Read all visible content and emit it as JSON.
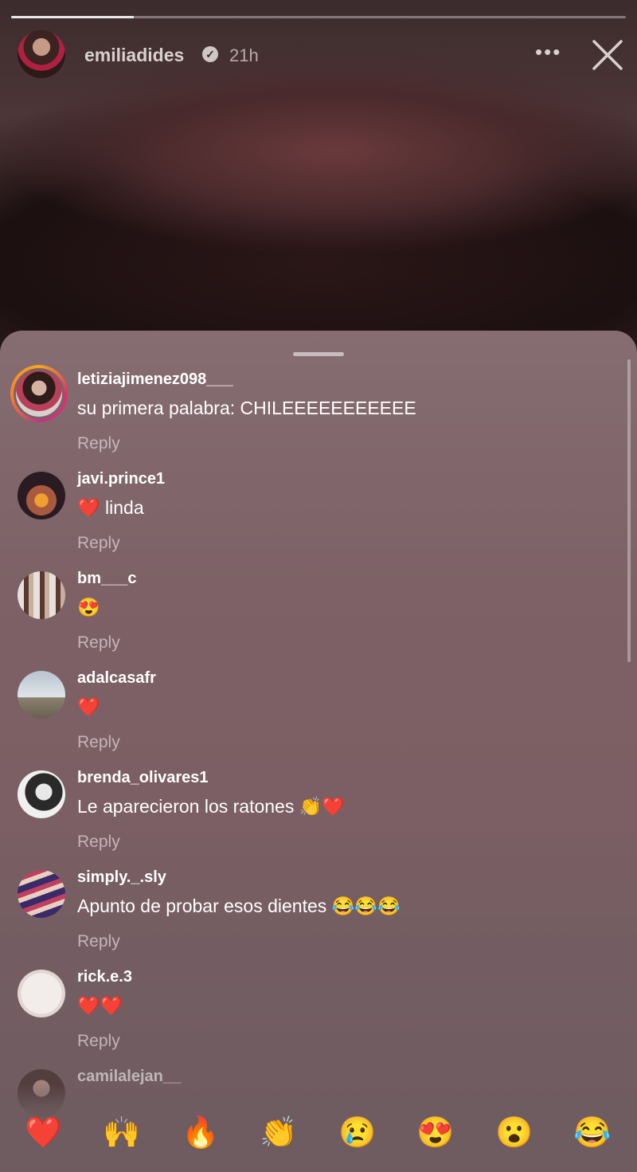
{
  "story": {
    "username": "emiliadides",
    "verified_mark": "✓",
    "time": "21h",
    "more_icon": "•••",
    "progress": 0.2
  },
  "comments": [
    {
      "username": "letiziajimenez098___",
      "text": "su primera palabra: CHILEEEEEEEEEEE",
      "reply": "Reply"
    },
    {
      "username": "javi.prince1",
      "text": "❤️ linda",
      "reply": "Reply"
    },
    {
      "username": "bm___c",
      "text": "😍",
      "reply": "Reply"
    },
    {
      "username": "adalcasafr",
      "text": "❤️",
      "reply": "Reply"
    },
    {
      "username": "brenda_olivares1",
      "text": "Le aparecieron los ratones 👏❤️",
      "reply": "Reply"
    },
    {
      "username": "simply._.sly",
      "text": "Apunto de probar esos dientes 😂😂😂",
      "reply": "Reply"
    },
    {
      "username": "rick.e.3",
      "text": "❤️❤️",
      "reply": "Reply"
    },
    {
      "username": "camilalejan__",
      "text": "",
      "reply": ""
    }
  ],
  "reactions": [
    "❤️",
    "🙌",
    "🔥",
    "👏",
    "😢",
    "😍",
    "😮",
    "😂"
  ]
}
